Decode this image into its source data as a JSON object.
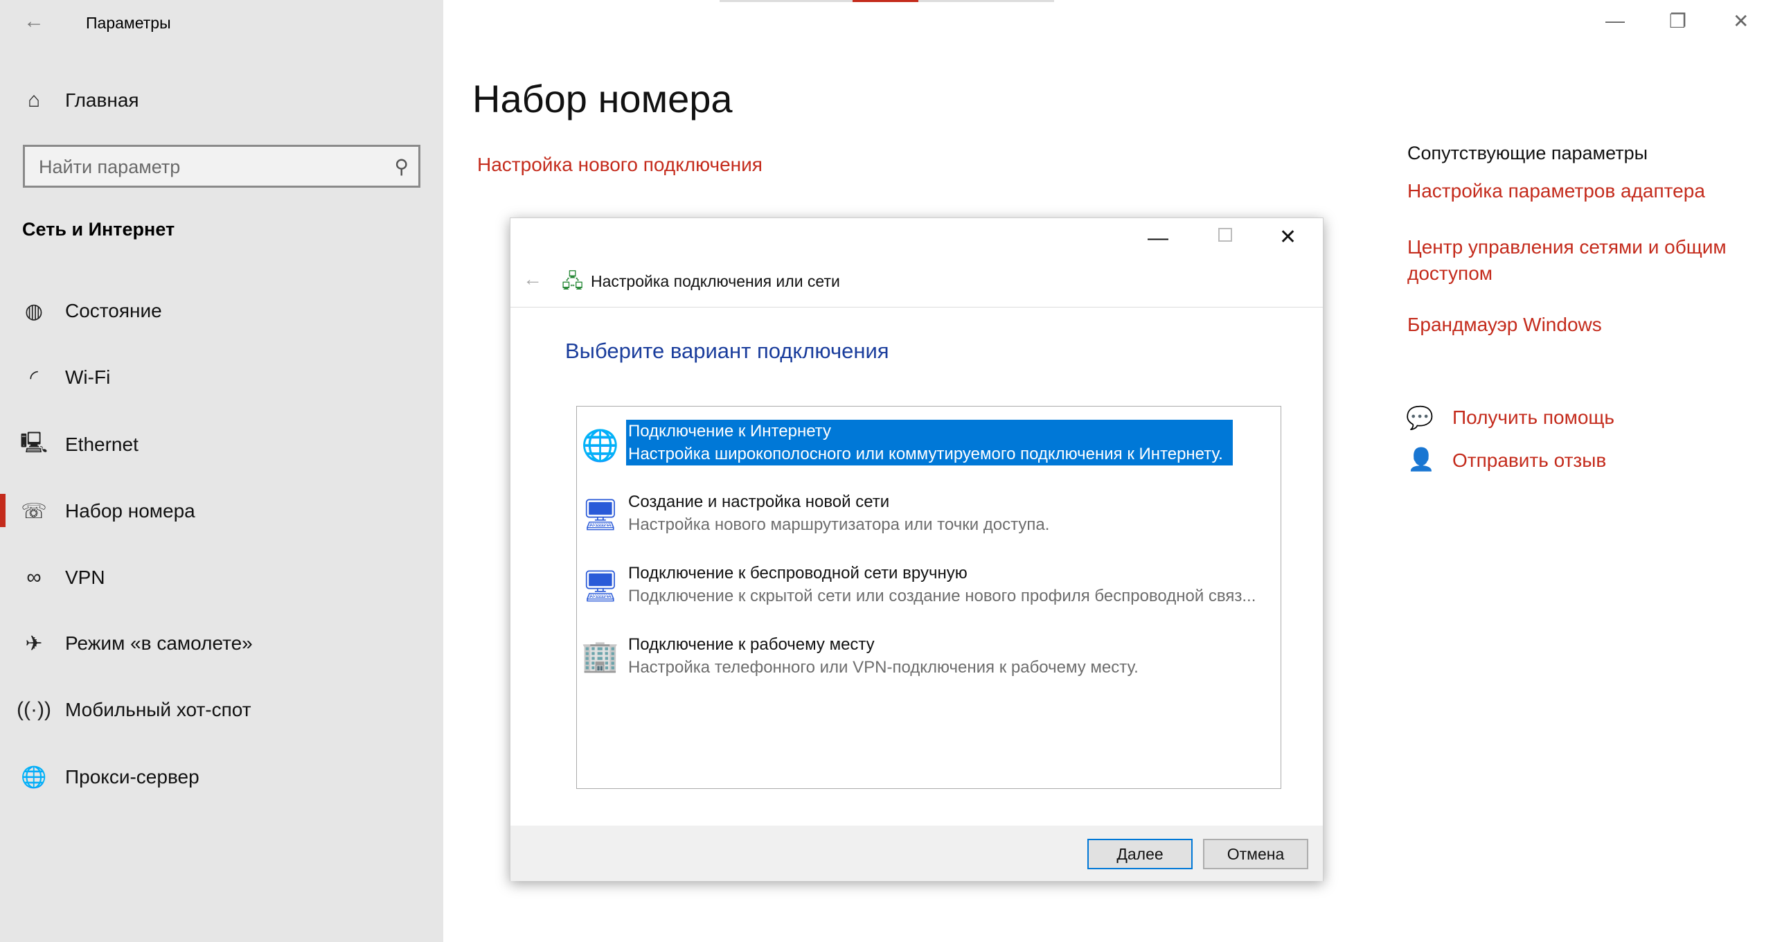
{
  "window": {
    "title": "Параметры",
    "minimize": "—",
    "maximize": "❐",
    "close": "✕"
  },
  "sidebar": {
    "home": "Главная",
    "search_placeholder": "Найти параметр",
    "section": "Сеть и Интернет",
    "items": [
      {
        "label": "Состояние",
        "icon": "globe-status-icon"
      },
      {
        "label": "Wi-Fi",
        "icon": "wifi-icon"
      },
      {
        "label": "Ethernet",
        "icon": "ethernet-icon"
      },
      {
        "label": "Набор номера",
        "icon": "dialup-icon",
        "active": true
      },
      {
        "label": "VPN",
        "icon": "vpn-icon"
      },
      {
        "label": "Режим «в самолете»",
        "icon": "airplane-icon"
      },
      {
        "label": "Мобильный хот-спот",
        "icon": "hotspot-icon"
      },
      {
        "label": "Прокси-сервер",
        "icon": "globe-icon"
      }
    ]
  },
  "main": {
    "title": "Набор номера",
    "setup_link": "Настройка нового подключения"
  },
  "related": {
    "heading": "Сопутствующие параметры",
    "links": [
      "Настройка параметров адаптера",
      "Центр управления сетями и общим доступом",
      "Брандмауэр Windows"
    ],
    "help": "Получить помощь",
    "feedback": "Отправить отзыв"
  },
  "dialog": {
    "title": "Настройка подключения или сети",
    "heading": "Выберите вариант подключения",
    "options": [
      {
        "title": "Подключение к Интернету",
        "desc": "Настройка широкополосного или коммутируемого подключения к Интернету.",
        "selected": true
      },
      {
        "title": "Создание и настройка новой сети",
        "desc": "Настройка нового маршрутизатора или точки доступа."
      },
      {
        "title": "Подключение к беспроводной сети вручную",
        "desc": "Подключение к скрытой сети или создание нового профиля беспроводной связ..."
      },
      {
        "title": "Подключение к рабочему месту",
        "desc": "Настройка телефонного или VPN-подключения к рабочему месту."
      }
    ],
    "next": "Далее",
    "cancel": "Отмена"
  },
  "colors": {
    "accent": "#c42b1c",
    "selection": "#0078d7",
    "heading_blue": "#1a3d9c"
  }
}
